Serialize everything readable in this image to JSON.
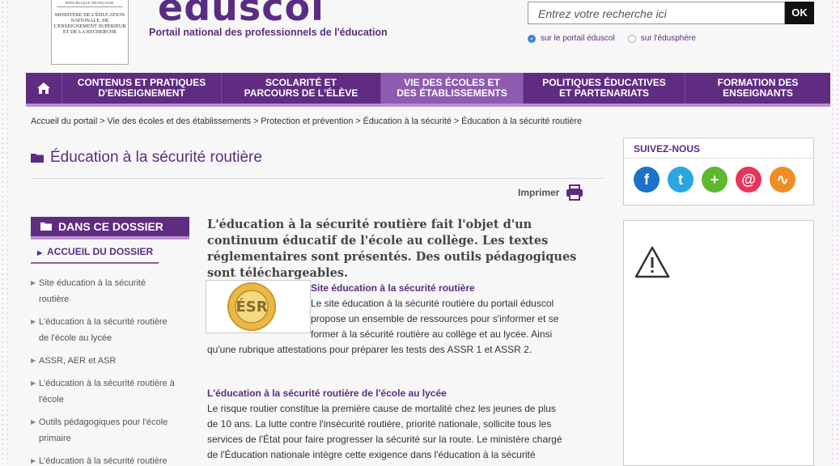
{
  "header": {
    "marianne_top": "RÉPUBLIQUE FRANÇAISE",
    "marianne_ministry": "MINISTÈRE DE L'ÉDUCATION NATIONALE, DE L'ENSEIGNEMENT SUPÉRIEUR ET DE LA RECHERCHE",
    "logo": "eduscol",
    "tagline": "Portail national des professionnels de l'éducation"
  },
  "search": {
    "placeholder": "Entrez votre recherche ici",
    "ok_label": "OK",
    "options": [
      {
        "label": "sur le portail éduscol",
        "checked": true
      },
      {
        "label": "sur l'édusphère",
        "checked": false
      }
    ]
  },
  "nav": {
    "items": [
      {
        "label": "CONTENUS ET PRATIQUES\nD'ENSEIGNEMENT"
      },
      {
        "label": "SCOLARITÉ ET\nPARCOURS DE L'ÉLÈVE"
      },
      {
        "label": "VIE DES ÉCOLES ET\nDES ÉTABLISSEMENTS",
        "active": true
      },
      {
        "label": "POLITIQUES ÉDUCATIVES\nET PARTENARIATS"
      },
      {
        "label": "FORMATION DES\nENSEIGNANTS"
      }
    ]
  },
  "breadcrumb": "Accueil du portail > Vie des écoles et des établissements > Protection et prévention > Éducation à la sécurité > Éducation à la sécurité routière",
  "page": {
    "title": "Éducation à la sécurité routière",
    "print_label": "Imprimer"
  },
  "dossier": {
    "heading": "DANS CE DOSSIER",
    "home": "ACCUEIL DU DOSSIER",
    "items": [
      "Site éducation à la sécurité routière",
      "L'éducation à la sécurité routière de l'école au lycée",
      "ASSR, AER et ASR",
      "L'éducation à la sécurité routière à l'école",
      "Outils pédagogiques pour l'école primaire",
      "L'éducation à la sécurité routière"
    ]
  },
  "content": {
    "chapo": "L'éducation à la sécurité routière fait l'objet d'un continuum éducatif de l'école au collège. Les textes réglementaires sont présentés. Des outils pédagogiques sont téléchargeables.",
    "blocks": [
      {
        "title": "Site éducation à la sécurité routière",
        "text_lines": [
          "Le site éducation à la sécurité routière du portail éduscol",
          "propose un ensemble de ressources pour s'informer et se",
          "former à la sécurité routière au collège et au lycée. Ainsi",
          "qu'une rubrique attestations pour préparer les tests des ASSR 1 et ASSR 2."
        ]
      },
      {
        "title": "L'éducation à la sécurité routière de l'école au lycée",
        "text_lines": [
          "Le risque routier constitue la première cause de mortalité chez les jeunes de plus",
          "de 10 ans. La lutte contre l'insécurité routière, priorité nationale, sollicite tous les",
          "services de l'État pour faire progresser la sécurité sur la route. Le ministère chargé",
          "de l'Éducation nationale intègre cette exigence dans l'éducation à la sécurité"
        ]
      }
    ],
    "thumb_text": "Éducation Sécurité Routière"
  },
  "sidebar": {
    "follow_heading": "SUIVEZ-NOUS",
    "socials": [
      {
        "icon": "facebook-icon",
        "color": "#1b72c9",
        "glyph": "f"
      },
      {
        "icon": "twitter-icon",
        "color": "#2aa6e0",
        "glyph": "t"
      },
      {
        "icon": "plus-icon",
        "color": "#5cb82e",
        "glyph": "+"
      },
      {
        "icon": "contact-icon",
        "color": "#e6345a",
        "glyph": "@"
      },
      {
        "icon": "rss-icon",
        "color": "#f08d25",
        "glyph": "∿"
      }
    ]
  },
  "colors": {
    "brand_purple": "#5f2c82",
    "nav_active": "#8d5bb0",
    "accent_lilac": "#b88fd0"
  }
}
